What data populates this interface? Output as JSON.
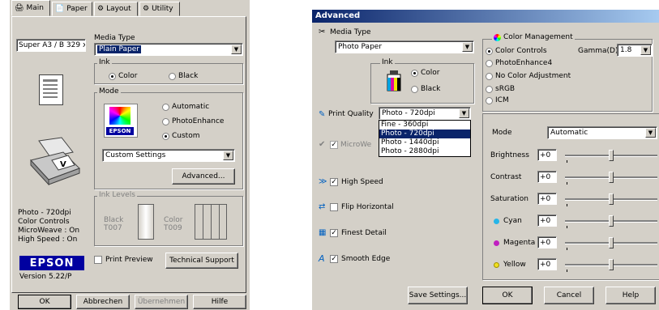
{
  "left": {
    "tabs": [
      "Main",
      "Paper",
      "Layout",
      "Utility"
    ],
    "paper_size": "Super A3 / B 329 x ...",
    "media_type_label": "Media Type",
    "media_type_value": "Plain Paper",
    "ink_label": "Ink",
    "ink_color": "Color",
    "ink_black": "Black",
    "mode_label": "Mode",
    "mode_automatic": "Automatic",
    "mode_photoenhance": "PhotoEnhance",
    "mode_custom": "Custom",
    "epson_badge": "EPSON",
    "custom_settings_value": "Custom Settings",
    "advanced_button": "Advanced...",
    "ink_levels_label": "Ink Levels",
    "black_cart": "Black",
    "black_code": "T007",
    "color_cart": "Color",
    "color_code": "T009",
    "summary": [
      "Photo - 720dpi",
      "Color Controls",
      "MicroWeave : On",
      "High Speed : On"
    ],
    "logo": "EPSON",
    "version": "Version 5.22/P",
    "print_preview": "Print Preview",
    "technical_support": "Technical Support",
    "ok": "OK",
    "abbrechen": "Abbrechen",
    "ubernehmen": "Übernehmen",
    "hilfe": "Hilfe"
  },
  "right": {
    "title": "Advanced",
    "media_type_label": "Media Type",
    "media_type_value": "Photo Paper",
    "ink_label": "Ink",
    "ink_color": "Color",
    "ink_black": "Black",
    "print_quality_label": "Print Quality",
    "print_quality_value": "Photo - 720dpi",
    "dropdown_options": [
      "Fine - 360dpi",
      "Photo - 720dpi",
      "Photo - 1440dpi",
      "Photo - 2880dpi"
    ],
    "microweave": "MicroWe",
    "high_speed": "High Speed",
    "flip_horizontal": "Flip Horizontal",
    "finest_detail": "Finest Detail",
    "smooth_edge": "Smooth Edge",
    "color_management_label": "Color Management",
    "cm_options": [
      "Color Controls",
      "PhotoEnhance4",
      "No Color Adjustment",
      "sRGB",
      "ICM"
    ],
    "gamma_label": "Gamma(D)",
    "gamma_value": "1.8",
    "mode_label": "Mode",
    "mode_value": "Automatic",
    "brightness": "Brightness",
    "contrast": "Contrast",
    "saturation": "Saturation",
    "cyan": "Cyan",
    "magenta": "Magenta",
    "yellow": "Yellow",
    "slider_value": "+0",
    "save_settings": "Save Settings...",
    "ok": "OK",
    "cancel": "Cancel",
    "help": "Help"
  },
  "colors": {
    "title_bar": "#0a246a",
    "cyan_dot": "#27b5e8",
    "magenta_dot": "#c020c0",
    "yellow_dot": "#f0e020",
    "epson_blue": "#0000a0"
  }
}
